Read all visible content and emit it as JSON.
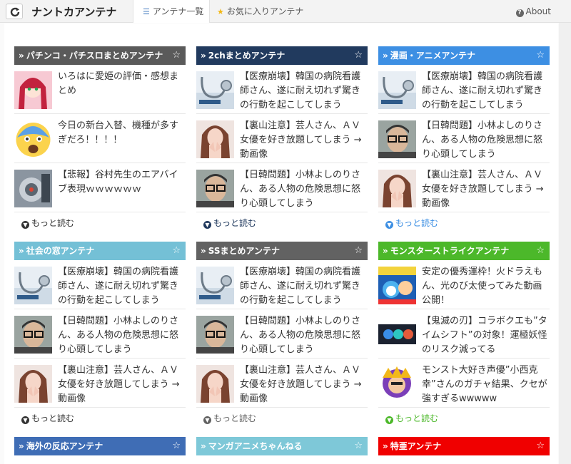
{
  "header": {
    "brand": "ナントカアンテナ",
    "tab_list": "アンテナ一覧",
    "tab_favorites": "お気に入りアンテナ",
    "about": "About"
  },
  "more_label": "もっと読む",
  "panels": [
    {
      "title": "パチンコ・パチスロまとめアンテナ",
      "color": "#5a5a5a",
      "items": [
        {
          "text": "いろはに愛姫の評価・感想まとめ",
          "thumb": "anime-girl"
        },
        {
          "text": "今日の新台入替、機種が多すぎだろ！！！！",
          "thumb": "scared-emoji"
        },
        {
          "text": "【悲報】谷村先生のエアバイブ表現ｗｗｗｗｗｗ",
          "thumb": "machine-photo"
        }
      ]
    },
    {
      "title": "2chまとめアンテナ",
      "color": "#213a5e",
      "items": [
        {
          "text": "【医療崩壊】韓国の病院看護師さん、遂に耐え切れず驚きの行動を起こしてしまう",
          "thumb": "stethoscope"
        },
        {
          "text": "【裏山注意】芸人さん、ＡＶ女優を好き放題してしまう →動画像",
          "thumb": "woman"
        },
        {
          "text": "【日韓問題】小林よしのりさん、ある人物の危険思想に怒り心頭してしまう",
          "thumb": "man-glasses"
        }
      ]
    },
    {
      "title": "漫画・アニメアンテナ",
      "color": "#3d8fe3",
      "items": [
        {
          "text": "【医療崩壊】韓国の病院看護師さん、遂に耐え切れず驚きの行動を起こしてしまう",
          "thumb": "stethoscope"
        },
        {
          "text": "【日韓問題】小林よしのりさん、ある人物の危険思想に怒り心頭してしまう",
          "thumb": "man-glasses"
        },
        {
          "text": "【裏山注意】芸人さん、ＡＶ女優を好き放題してしまう →動画像",
          "thumb": "woman"
        }
      ]
    },
    {
      "title": "社会の窓アンテナ",
      "color": "#74c0d6",
      "items": [
        {
          "text": "【医療崩壊】韓国の病院看護師さん、遂に耐え切れず驚きの行動を起こしてしまう",
          "thumb": "stethoscope"
        },
        {
          "text": "【日韓問題】小林よしのりさん、ある人物の危険思想に怒り心頭してしまう",
          "thumb": "man-glasses"
        },
        {
          "text": "【裏山注意】芸人さん、ＡＶ女優を好き放題してしまう →動画像",
          "thumb": "woman"
        }
      ]
    },
    {
      "title": "SSまとめアンテナ",
      "color": "#626262",
      "items": [
        {
          "text": "【医療崩壊】韓国の病院看護師さん、遂に耐え切れず驚きの行動を起こしてしまう",
          "thumb": "stethoscope"
        },
        {
          "text": "【日韓問題】小林よしのりさん、ある人物の危険思想に怒り心頭してしまう",
          "thumb": "man-glasses"
        },
        {
          "text": "【裏山注意】芸人さん、ＡＶ女優を好き放題してしまう →動画像",
          "thumb": "woman"
        }
      ]
    },
    {
      "title": "モンスターストライクアンテナ",
      "color": "#4cb82a",
      "items": [
        {
          "text": "安定の優秀運枠！火ドラえもん、光のび太使ってみた動画公開！",
          "thumb": "game-blue"
        },
        {
          "text": "【鬼滅の刃】コラボクエも”タイムシフト”の対象！運極妖怪のリスク減ってるぞ！！！！！",
          "thumb": "game-dark"
        },
        {
          "text": "モンスト大好き声優”小西克幸”さんのガチャ結果、クセが強すぎるwwwww",
          "thumb": "game-char"
        }
      ]
    },
    {
      "title": "海外の反応アンテナ",
      "color": "#3f6db5",
      "items": []
    },
    {
      "title": "マンガアニメちゃんねる",
      "color": "#7ec8d8",
      "items": []
    },
    {
      "title": "特亜アンテナ",
      "color": "#f00000",
      "items": []
    }
  ]
}
